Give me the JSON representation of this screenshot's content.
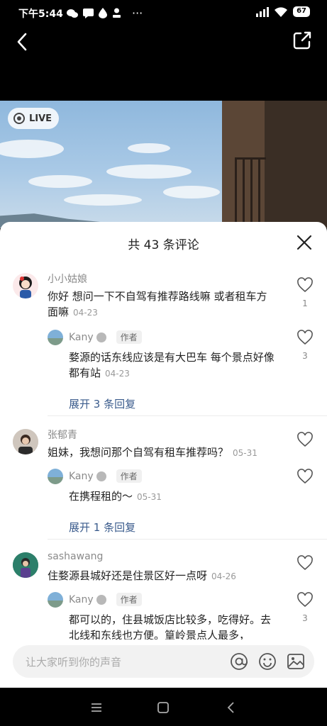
{
  "status_bar": {
    "time": "下午5:44",
    "battery": "67",
    "dots": "···"
  },
  "photo": {
    "live_label": "LIVE"
  },
  "sheet": {
    "title": "共 43 条评论"
  },
  "comments": [
    {
      "username": "小小姑娘",
      "text": "你好 想问一下不自驾有推荐路线嘛 或者租车方面嘛",
      "time": "04-23",
      "likes": "1",
      "reply": {
        "username": "Kany",
        "tag": "作者",
        "text": "婺源的话东线应该是有大巴车 每个景点好像都有站",
        "time": "04-23",
        "likes": "3"
      },
      "expand": "展开 3 条回复"
    },
    {
      "username": "张郁青",
      "text": "姐妹，我想问那个自驾有租车推荐吗？",
      "time": "05-31",
      "likes": "",
      "reply": {
        "username": "Kany",
        "tag": "作者",
        "text": "在携程租的～",
        "time": "05-31",
        "likes": ""
      },
      "expand": "展开 1 条回复"
    },
    {
      "username": "sashawang",
      "text": "住婺源县城好还是住景区好一点呀",
      "time": "04-26",
      "likes": "",
      "reply": {
        "username": "Kany",
        "tag": "作者",
        "text": "都可以的，住县城饭店比较多，吃得好。去北线和东线也方便。篁岭景点人最多，",
        "time": "",
        "likes": "3"
      }
    }
  ],
  "input": {
    "placeholder": "让大家听到你的声音"
  }
}
